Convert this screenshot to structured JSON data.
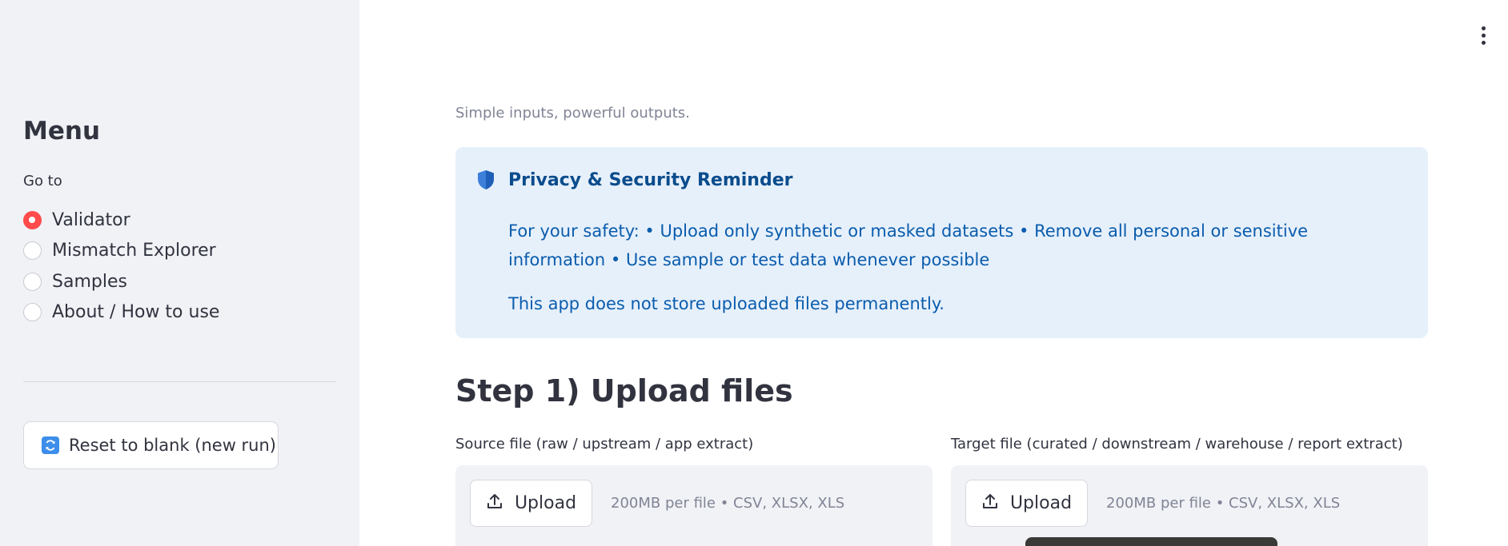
{
  "sidebar": {
    "title": "Menu",
    "goto_label": "Go to",
    "nav_items": [
      {
        "label": "Validator",
        "selected": true
      },
      {
        "label": "Mismatch Explorer",
        "selected": false
      },
      {
        "label": "Samples",
        "selected": false
      },
      {
        "label": "About / How to use",
        "selected": false
      }
    ],
    "reset_label": "Reset to blank (new run)",
    "reset_icon": "refresh-icon"
  },
  "main": {
    "subtitle": "Simple inputs, powerful outputs.",
    "privacy": {
      "icon": "shield-icon",
      "title": "Privacy & Security Reminder",
      "body": "For your safety: • Upload only synthetic or masked datasets • Remove all personal or sensitive information • Use sample or test data whenever possible",
      "note": "This app does not store uploaded files permanently."
    },
    "step_heading": "Step 1) Upload files",
    "source": {
      "label": "Source file (raw / upstream / app extract)",
      "button_label": "Upload",
      "hint": "200MB per file • CSV, XLSX, XLS"
    },
    "target": {
      "label": "Target file (curated / downstream / warehouse / report extract)",
      "button_label": "Upload",
      "hint": "200MB per file • CSV, XLSX, XLS"
    }
  },
  "colors": {
    "accent": "#ff4b4b",
    "info_bg": "#e6f0fb",
    "info_text": "#0a5cad",
    "sidebar_bg": "#f0f2f6"
  }
}
